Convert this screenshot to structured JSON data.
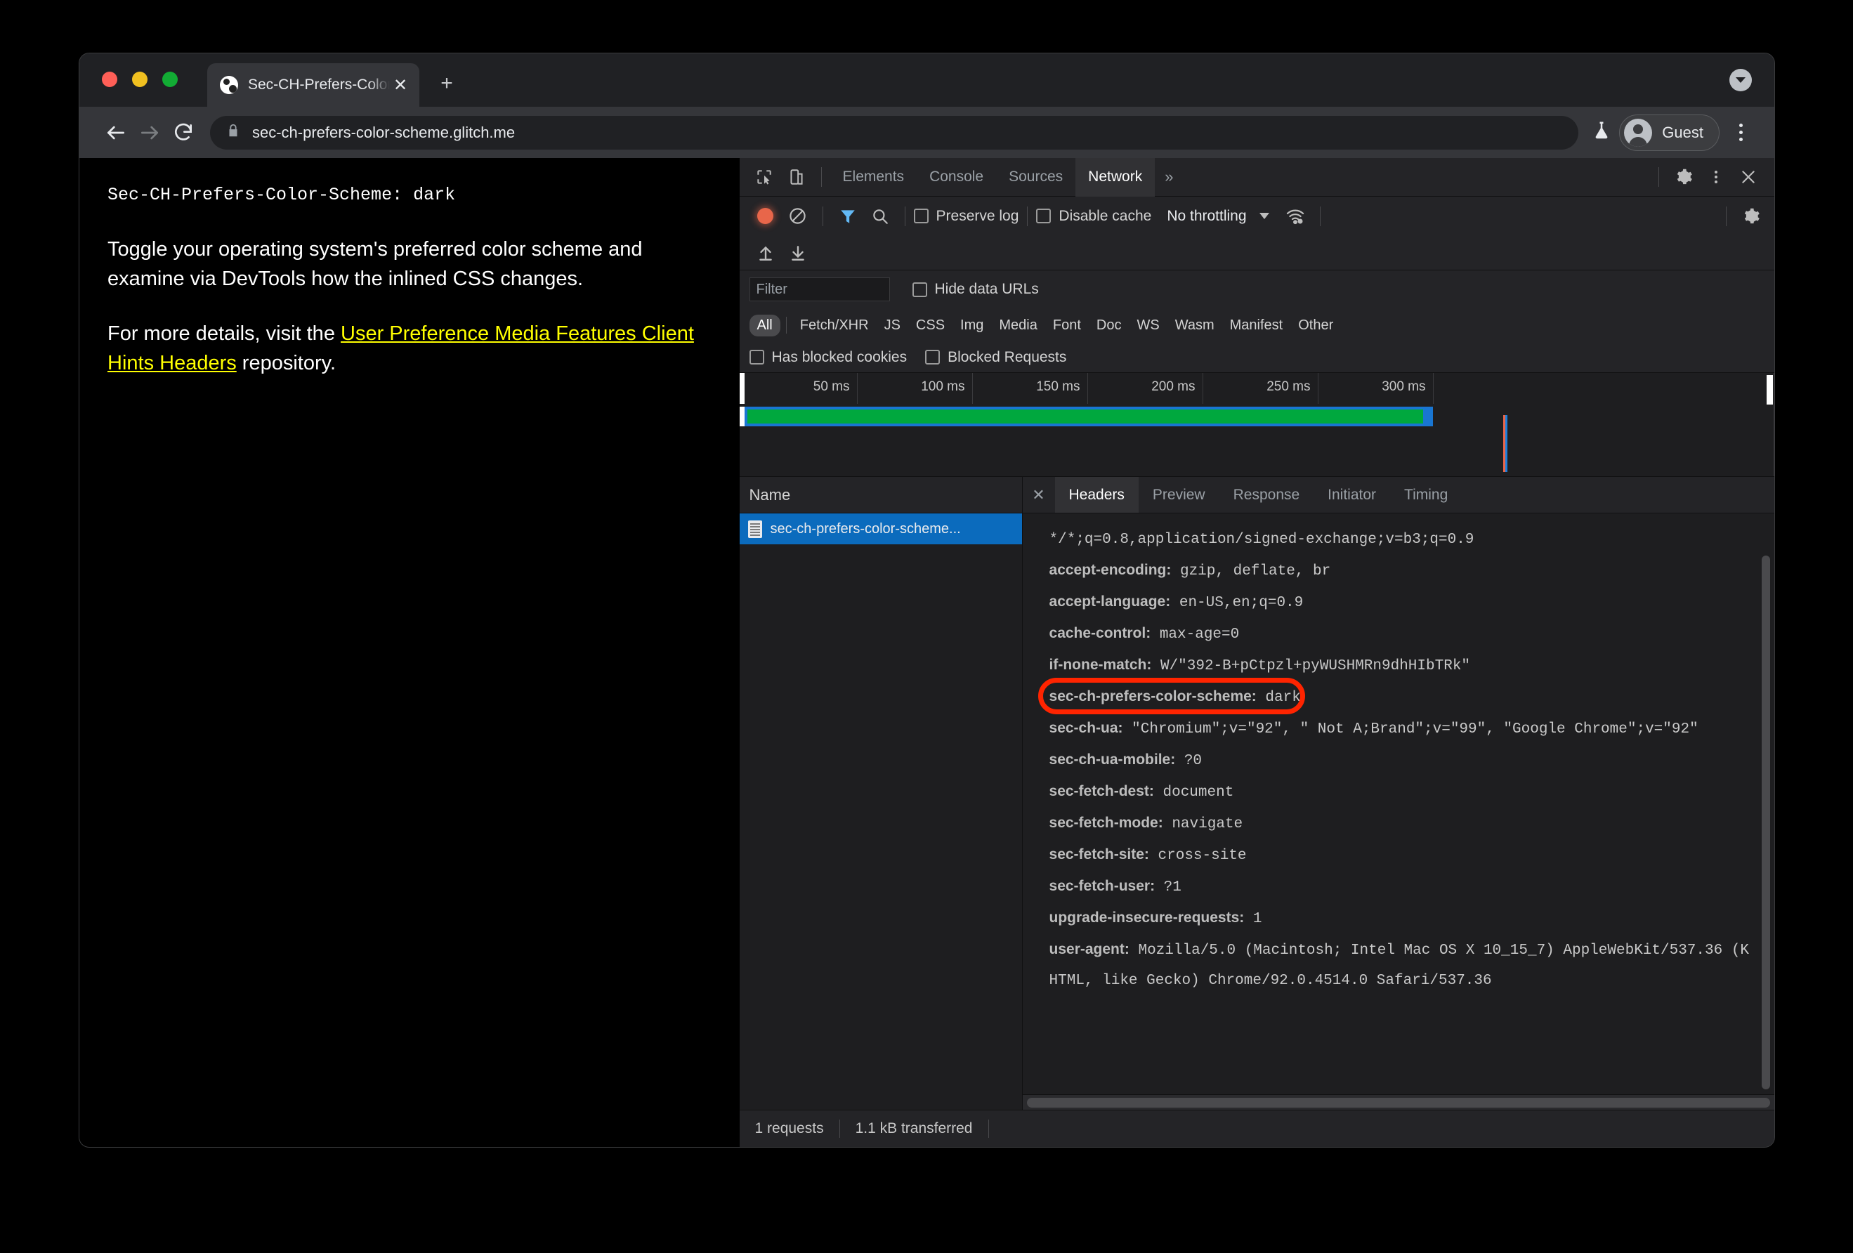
{
  "browser": {
    "tab": {
      "title": "Sec-CH-Prefers-Color-Scheme",
      "close_label": "✕"
    },
    "new_tab_label": "+",
    "omnibox": {
      "url": "sec-ch-prefers-color-scheme.glitch.me",
      "lock_icon": "lock-icon"
    },
    "profile_label": "Guest",
    "back_icon": "back-arrow-icon",
    "forward_icon": "forward-arrow-icon",
    "reload_icon": "reload-icon",
    "flask_icon": "flask-icon",
    "menu_icon": "three-dot-menu-icon",
    "tabstrip_menu_icon": "tab-search-chevron-icon"
  },
  "page": {
    "header_line": "Sec-CH-Prefers-Color-Scheme: dark",
    "paragraph_1": "Toggle your operating system's preferred color scheme and examine via DevTools how the inlined CSS changes.",
    "paragraph_2_before": "For more details, visit the ",
    "link_text": "User Preference Media Features Client Hints Headers",
    "paragraph_2_after": " repository.",
    "link_color": "#ffff00"
  },
  "devtools": {
    "main_tabs": [
      {
        "label": "Elements",
        "active": false
      },
      {
        "label": "Console",
        "active": false
      },
      {
        "label": "Sources",
        "active": false
      },
      {
        "label": "Network",
        "active": true
      }
    ],
    "more_tabs_label": "»",
    "inspect_icon": "inspect-element-icon",
    "device_icon": "device-toolbar-icon",
    "settings_icon": "gear-icon",
    "kebab_icon": "three-dot-menu-icon",
    "close_icon": "close-icon",
    "network_toolbar": {
      "record_icon": "record-button-icon",
      "clear_icon": "clear-network-log-icon",
      "filter_icon": "filter-funnel-icon",
      "search_icon": "search-magnifier-icon",
      "preserve_log_label": "Preserve log",
      "preserve_log_checked": false,
      "disable_cache_label": "Disable cache",
      "disable_cache_checked": false,
      "throttling_value": "No throttling",
      "network_conditions_icon": "wifi-settings-icon",
      "capture_settings_icon": "gear-icon",
      "import_icon": "import-har-icon",
      "export_icon": "export-har-icon"
    },
    "filter_bar": {
      "filter_placeholder": "Filter",
      "filter_value": "",
      "hide_data_urls_label": "Hide data URLs",
      "hide_data_urls_checked": false,
      "types": [
        {
          "label": "All",
          "active": true
        },
        {
          "label": "Fetch/XHR",
          "active": false
        },
        {
          "label": "JS",
          "active": false
        },
        {
          "label": "CSS",
          "active": false
        },
        {
          "label": "Img",
          "active": false
        },
        {
          "label": "Media",
          "active": false
        },
        {
          "label": "Font",
          "active": false
        },
        {
          "label": "Doc",
          "active": false
        },
        {
          "label": "WS",
          "active": false
        },
        {
          "label": "Wasm",
          "active": false
        },
        {
          "label": "Manifest",
          "active": false
        },
        {
          "label": "Other",
          "active": false
        }
      ],
      "has_blocked_cookies_label": "Has blocked cookies",
      "has_blocked_cookies_checked": false,
      "blocked_requests_label": "Blocked Requests",
      "blocked_requests_checked": false
    },
    "overview": {
      "ticks": [
        "50 ms",
        "100 ms",
        "150 ms",
        "200 ms",
        "250 ms",
        "300 ms"
      ],
      "bar_color_outer": "#1976d2",
      "bar_color_inner": "#00a83e",
      "dcl_marker_color": "#1a7fdb",
      "load_marker_color": "#e8664a"
    },
    "request_list": {
      "column_header": "Name",
      "rows": [
        {
          "name": "sec-ch-prefers-color-scheme...",
          "icon": "document-icon",
          "selected": true
        }
      ]
    },
    "detail": {
      "close_label": "✕",
      "tabs": [
        {
          "label": "Headers",
          "active": true
        },
        {
          "label": "Preview",
          "active": false
        },
        {
          "label": "Response",
          "active": false
        },
        {
          "label": "Initiator",
          "active": false
        },
        {
          "label": "Timing",
          "active": false
        }
      ],
      "headers": [
        {
          "name": "",
          "value": "*/*;q=0.8,application/signed-exchange;v=b3;q=0.9",
          "highlighted": false
        },
        {
          "name": "accept-encoding:",
          "value": " gzip, deflate, br",
          "highlighted": false
        },
        {
          "name": "accept-language:",
          "value": " en-US,en;q=0.9",
          "highlighted": false
        },
        {
          "name": "cache-control:",
          "value": " max-age=0",
          "highlighted": false
        },
        {
          "name": "if-none-match:",
          "value": " W/\"392-B+pCtpzl+pyWUSHMRn9dhHIbTRk\"",
          "highlighted": false
        },
        {
          "name": "sec-ch-prefers-color-scheme:",
          "value": " dark",
          "highlighted": true
        },
        {
          "name": "sec-ch-ua:",
          "value": " \"Chromium\";v=\"92\", \" Not A;Brand\";v=\"99\", \"Google Chrome\";v=\"92\"",
          "highlighted": false
        },
        {
          "name": "sec-ch-ua-mobile:",
          "value": " ?0",
          "highlighted": false
        },
        {
          "name": "sec-fetch-dest:",
          "value": " document",
          "highlighted": false
        },
        {
          "name": "sec-fetch-mode:",
          "value": " navigate",
          "highlighted": false
        },
        {
          "name": "sec-fetch-site:",
          "value": " cross-site",
          "highlighted": false
        },
        {
          "name": "sec-fetch-user:",
          "value": " ?1",
          "highlighted": false
        },
        {
          "name": "upgrade-insecure-requests:",
          "value": " 1",
          "highlighted": false
        },
        {
          "name": "user-agent:",
          "value": " Mozilla/5.0 (Macintosh; Intel Mac OS X 10_15_7) AppleWebKit/537.36 (KHTML, like Gecko) Chrome/92.0.4514.0 Safari/537.36",
          "highlighted": false
        }
      ],
      "annotation_color": "#ff2400"
    },
    "status_bar": {
      "requests": "1 requests",
      "transferred": "1.1 kB transferred"
    }
  }
}
